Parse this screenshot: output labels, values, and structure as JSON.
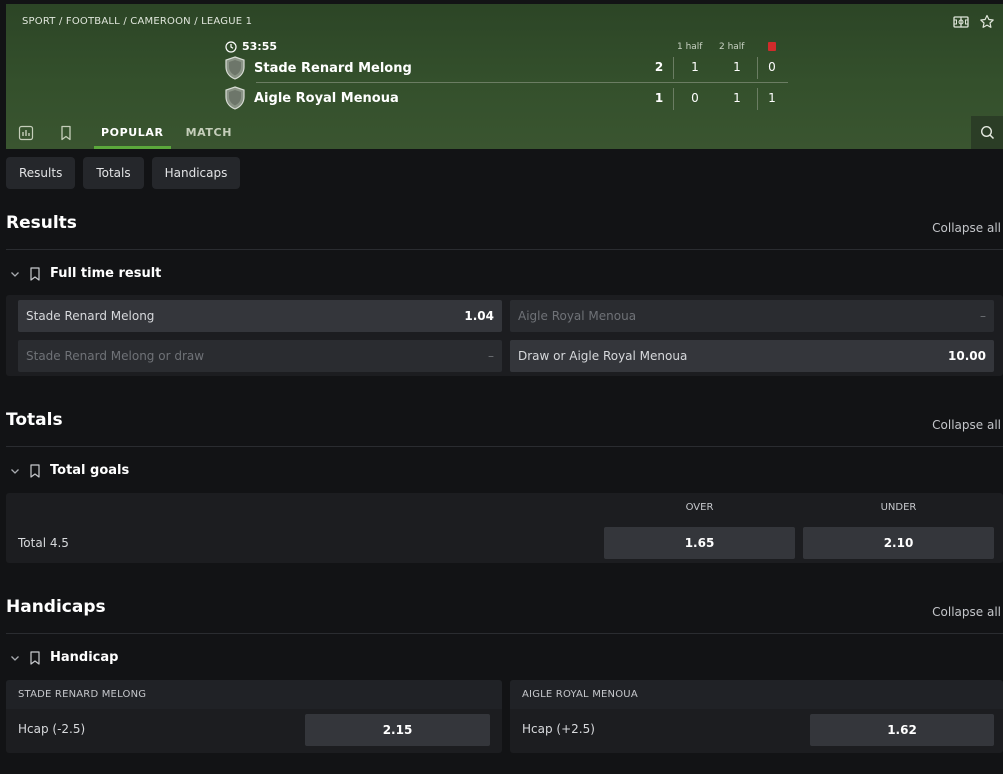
{
  "header": {
    "breadcrumb": "SPORT / FOOTBALL / CAMEROON / LEAGUE 1",
    "clock": "53:55",
    "period1_label": "1 half",
    "period2_label": "2 half",
    "teams": [
      {
        "name": "Stade Renard Melong",
        "total": "2",
        "half1": "1",
        "half2": "1",
        "red": "0"
      },
      {
        "name": "Aigle Royal Menoua",
        "total": "1",
        "half1": "0",
        "half2": "1",
        "red": "1"
      }
    ],
    "tabs": {
      "popular": "POPULAR",
      "match": "MATCH"
    }
  },
  "chips": [
    "Results",
    "Totals",
    "Handicaps"
  ],
  "sections": {
    "results": {
      "title": "Results",
      "collapse": "Collapse all",
      "market": "Full time result",
      "odds": [
        {
          "label": "Stade Renard Melong",
          "value": "1.04"
        },
        {
          "label": "Aigle Royal Menoua",
          "value": "–"
        },
        {
          "label": "Stade Renard Melong or draw",
          "value": "–"
        },
        {
          "label": "Draw or Aigle Royal Menoua",
          "value": "10.00"
        }
      ]
    },
    "totals": {
      "title": "Totals",
      "collapse": "Collapse all",
      "market": "Total goals",
      "over": "OVER",
      "under": "UNDER",
      "row_label": "Total 4.5",
      "over_value": "1.65",
      "under_value": "2.10"
    },
    "handicaps": {
      "title": "Handicaps",
      "collapse": "Collapse all",
      "market": "Handicap",
      "home_head": "STADE RENARD MELONG",
      "away_head": "AIGLE ROYAL MENOUA",
      "home_label": "Hcap (-2.5)",
      "home_value": "2.15",
      "away_label": "Hcap (+2.5)",
      "away_value": "1.62"
    }
  },
  "colors": {
    "header_green": "#34502c",
    "active_tab": "#5ba83b",
    "red_card": "#d12b2b",
    "bg": "#121315"
  }
}
